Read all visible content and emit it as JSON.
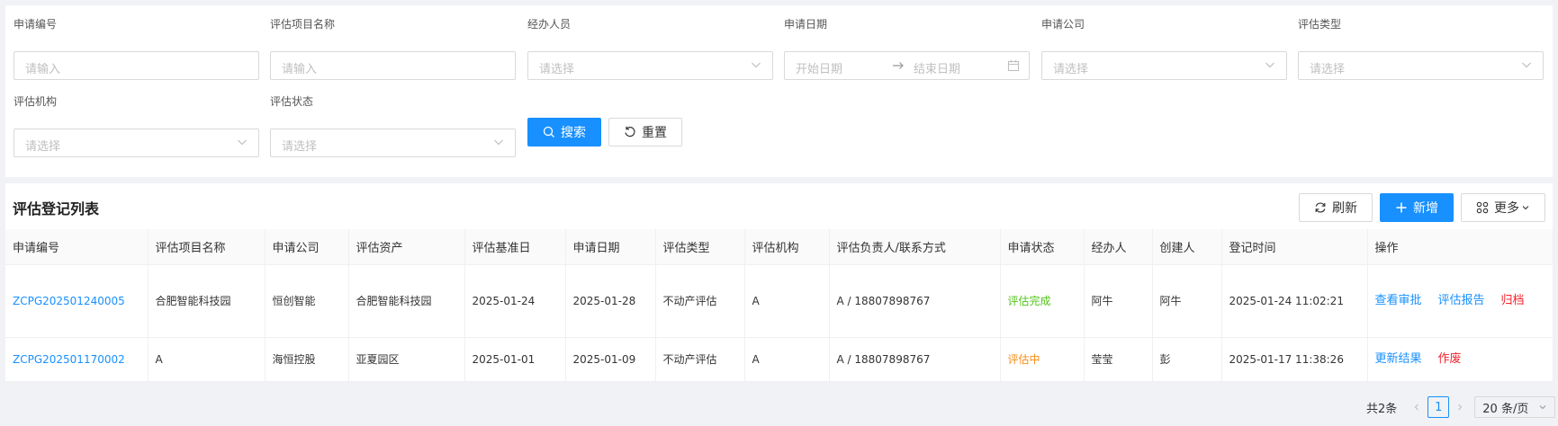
{
  "filters": {
    "apply_no": {
      "label": "申请编号",
      "placeholder": "请输入"
    },
    "project_name": {
      "label": "评估项目名称",
      "placeholder": "请输入"
    },
    "handler": {
      "label": "经办人员",
      "placeholder": "请选择"
    },
    "apply_date": {
      "label": "申请日期",
      "start_placeholder": "开始日期",
      "end_placeholder": "结束日期"
    },
    "company": {
      "label": "申请公司",
      "placeholder": "请选择"
    },
    "eval_type": {
      "label": "评估类型",
      "placeholder": "请选择"
    },
    "agency": {
      "label": "评估机构",
      "placeholder": "请选择"
    },
    "status": {
      "label": "评估状态",
      "placeholder": "请选择"
    },
    "search_label": "搜索",
    "reset_label": "重置"
  },
  "list": {
    "title": "评估登记列表",
    "refresh_label": "刷新",
    "add_label": "新增",
    "more_label": "更多",
    "columns": [
      "申请编号",
      "评估项目名称",
      "申请公司",
      "评估资产",
      "评估基准日",
      "申请日期",
      "评估类型",
      "评估机构",
      "评估负责人/联系方式",
      "申请状态",
      "经办人",
      "创建人",
      "登记时间",
      "操作"
    ],
    "rows": [
      {
        "apply_no": "ZCPG202501240005",
        "project_name": "合肥智能科技园",
        "company": "恒创智能",
        "asset": "合肥智能科技园",
        "base_date": "2025-01-24",
        "apply_date": "2025-01-28",
        "eval_type": "不动产评估",
        "agency": "A",
        "contact": "A / 18807898767",
        "status": "评估完成",
        "handler": "阿牛",
        "creator": "阿牛",
        "reg_time": "2025-01-24 11:02:21",
        "ops": [
          "查看审批",
          "评估报告",
          "归档"
        ]
      },
      {
        "apply_no": "ZCPG202501170002",
        "project_name": "A",
        "company": "海恒控股",
        "asset": "亚夏园区",
        "base_date": "2025-01-01",
        "apply_date": "2025-01-09",
        "eval_type": "不动产评估",
        "agency": "A",
        "contact": "A / 18807898767",
        "status": "评估中",
        "handler": "莹莹",
        "creator": "彭",
        "reg_time": "2025-01-17 11:38:26",
        "ops": [
          "更新结果",
          "作废"
        ]
      }
    ]
  },
  "pagination": {
    "total_text": "共2条",
    "current_page": "1",
    "page_size": "20 条/页"
  },
  "colors": {
    "primary": "#1890ff",
    "success": "#52c41a",
    "warning": "#fa8c16",
    "danger": "#f5222d"
  }
}
